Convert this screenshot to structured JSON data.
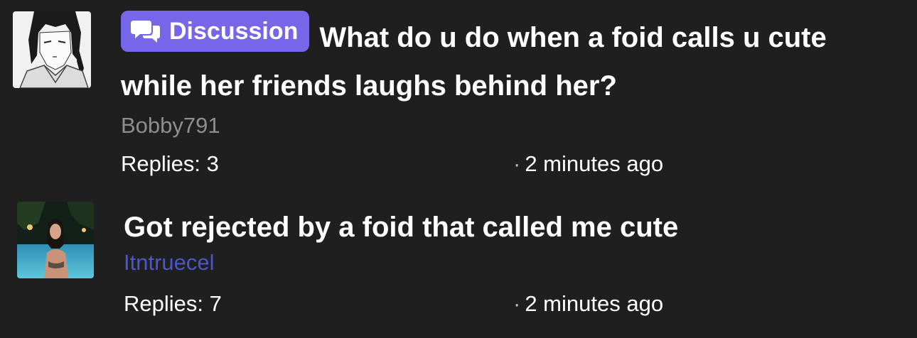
{
  "threads": [
    {
      "prefix": "Discussion",
      "prefix_icon": "chat-bubbles-icon",
      "title": "What do u do when a foid calls u cute while her friends laughs behind her?",
      "author": "Bobby791",
      "replies_label": "Replies: 3",
      "time_dot": "·",
      "time": "2 minutes ago",
      "colors": {
        "badge": "#7766e8",
        "author": "#8e8e8e"
      }
    },
    {
      "title": "Got rejected by a foid that called me cute",
      "author": "Itntruecel",
      "replies_label": "Replies: 7",
      "time_dot": "·",
      "time": "2 minutes ago",
      "colors": {
        "author": "#4c56c8"
      }
    }
  ],
  "colors": {
    "background": "#1f1f20",
    "text": "#ffffff"
  }
}
